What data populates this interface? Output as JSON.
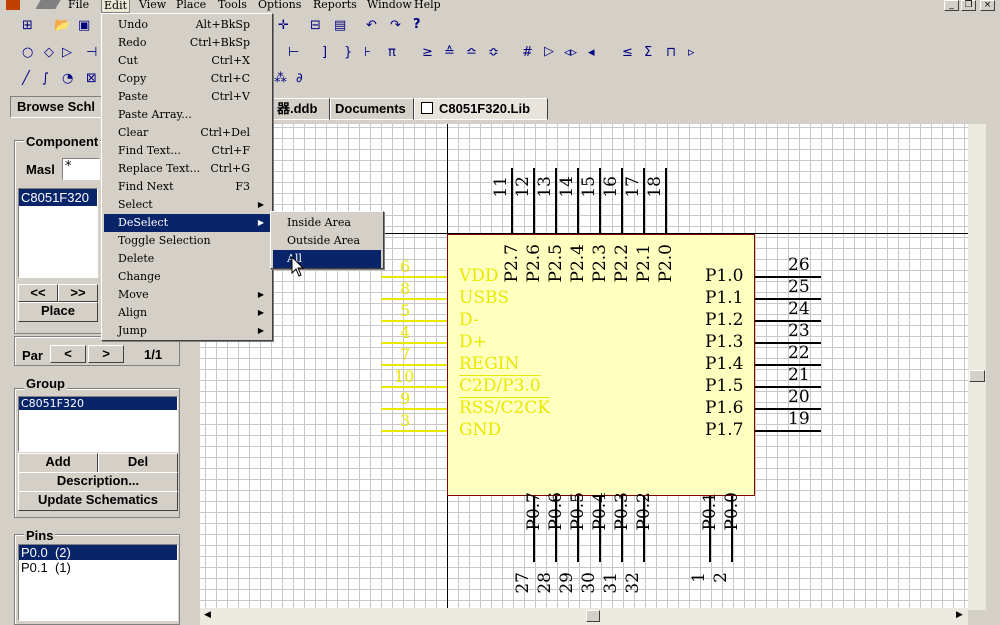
{
  "menubar": {
    "items": [
      "File",
      "Edit",
      "View",
      "Place",
      "Tools",
      "Options",
      "Reports",
      "Window",
      "Help"
    ]
  },
  "toolbar": {
    "row2_symbols": [
      "≥",
      "≙",
      "≏",
      "≎",
      "#",
      "▷",
      "◃▹",
      "◂",
      "≤",
      "Σ",
      "⊓",
      "▹"
    ],
    "row3_symbols": [
      "Ω",
      "⊠",
      "∿"
    ]
  },
  "left_panel": {
    "browse_title": "Browse Schl",
    "components_label": "Component",
    "mask_label": "Masl",
    "mask_value": "*",
    "component_list": [
      "C8051F320"
    ],
    "prev_button": "<<",
    "next_button": ">>",
    "place_button": "Place",
    "part_label": "Par",
    "part_prev": "<",
    "part_next": ">",
    "part_counter": "1/1",
    "group_label": "Group",
    "group_list": [
      "C8051F320"
    ],
    "add_button": "Add",
    "del_button": "Del",
    "description_button": "Description...",
    "update_button": "Update Schematics",
    "pins_label": "Pins",
    "pins_list": [
      "P0.0  (2)",
      "P0.1  (1)"
    ]
  },
  "tabs": [
    "器.ddb",
    "Documents",
    "C8051F320.Lib"
  ],
  "edit_menu": {
    "items": [
      {
        "label": "Undo",
        "shortcut": "Alt+BkSp"
      },
      {
        "label": "Redo",
        "shortcut": "Ctrl+BkSp"
      },
      {
        "label": "Cut",
        "shortcut": "Ctrl+X"
      },
      {
        "label": "Copy",
        "shortcut": "Ctrl+C"
      },
      {
        "label": "Paste",
        "shortcut": "Ctrl+V"
      },
      {
        "label": "Paste Array...",
        "shortcut": ""
      },
      {
        "label": "Clear",
        "shortcut": "Ctrl+Del"
      },
      {
        "label": "Find Text...",
        "shortcut": "Ctrl+F"
      },
      {
        "label": "Replace Text...",
        "shortcut": "Ctrl+G"
      },
      {
        "label": "Find Next",
        "shortcut": "F3"
      },
      {
        "label": "Select",
        "shortcut": ""
      },
      {
        "label": "DeSelect",
        "shortcut": ""
      },
      {
        "label": "Toggle Selection",
        "shortcut": ""
      },
      {
        "label": "Delete",
        "shortcut": ""
      },
      {
        "label": "Change",
        "shortcut": ""
      },
      {
        "label": "Move",
        "shortcut": ""
      },
      {
        "label": "Align",
        "shortcut": ""
      },
      {
        "label": "Jump",
        "shortcut": ""
      }
    ]
  },
  "deselect_menu": {
    "items": [
      "Inside Area",
      "Outside Area",
      "All"
    ]
  },
  "schematic": {
    "top_pins": [
      {
        "num": "11",
        "name": ""
      },
      {
        "num": "12",
        "name": "P2.7"
      },
      {
        "num": "13",
        "name": "P2.6"
      },
      {
        "num": "14",
        "name": "P2.5"
      },
      {
        "num": "15",
        "name": "P2.4"
      },
      {
        "num": "16",
        "name": "P2.3"
      },
      {
        "num": "17",
        "name": "P2.2"
      },
      {
        "num": "18",
        "name": "P2.1"
      },
      {
        "num": "",
        "name": "P2.0"
      }
    ],
    "right_pins": [
      {
        "num": "26",
        "name": "P1.0"
      },
      {
        "num": "25",
        "name": "P1.1"
      },
      {
        "num": "24",
        "name": "P1.2"
      },
      {
        "num": "23",
        "name": "P1.3"
      },
      {
        "num": "22",
        "name": "P1.4"
      },
      {
        "num": "21",
        "name": "P1.5"
      },
      {
        "num": "20",
        "name": "P1.6"
      },
      {
        "num": "19",
        "name": "P1.7"
      }
    ],
    "left_pins": [
      {
        "num": "6",
        "name": "VDD"
      },
      {
        "num": "8",
        "name": "USBS"
      },
      {
        "num": "5",
        "name": "D-"
      },
      {
        "num": "4",
        "name": "D+"
      },
      {
        "num": "7",
        "name": "REGIN"
      },
      {
        "num": "10",
        "name": "C2D/P3.0"
      },
      {
        "num": "9",
        "name": "RSS/C2CK"
      },
      {
        "num": "3",
        "name": "GND"
      }
    ],
    "bottom_pins": [
      {
        "num": "27",
        "name": "P0.7"
      },
      {
        "num": "28",
        "name": "P0.6"
      },
      {
        "num": "29",
        "name": "P0.5"
      },
      {
        "num": "30",
        "name": "P0.4"
      },
      {
        "num": "31",
        "name": "P0.3"
      },
      {
        "num": "32",
        "name": "P0.2"
      },
      {
        "num": "1",
        "name": "P0.1"
      },
      {
        "num": "2",
        "name": "P0.0"
      }
    ]
  },
  "colors": {
    "selection": "#0a246a",
    "chip_fill": "#ffffc0",
    "chip_border": "#800000",
    "deselected_pin": "#e8e800",
    "face": "#d4d0c8"
  }
}
